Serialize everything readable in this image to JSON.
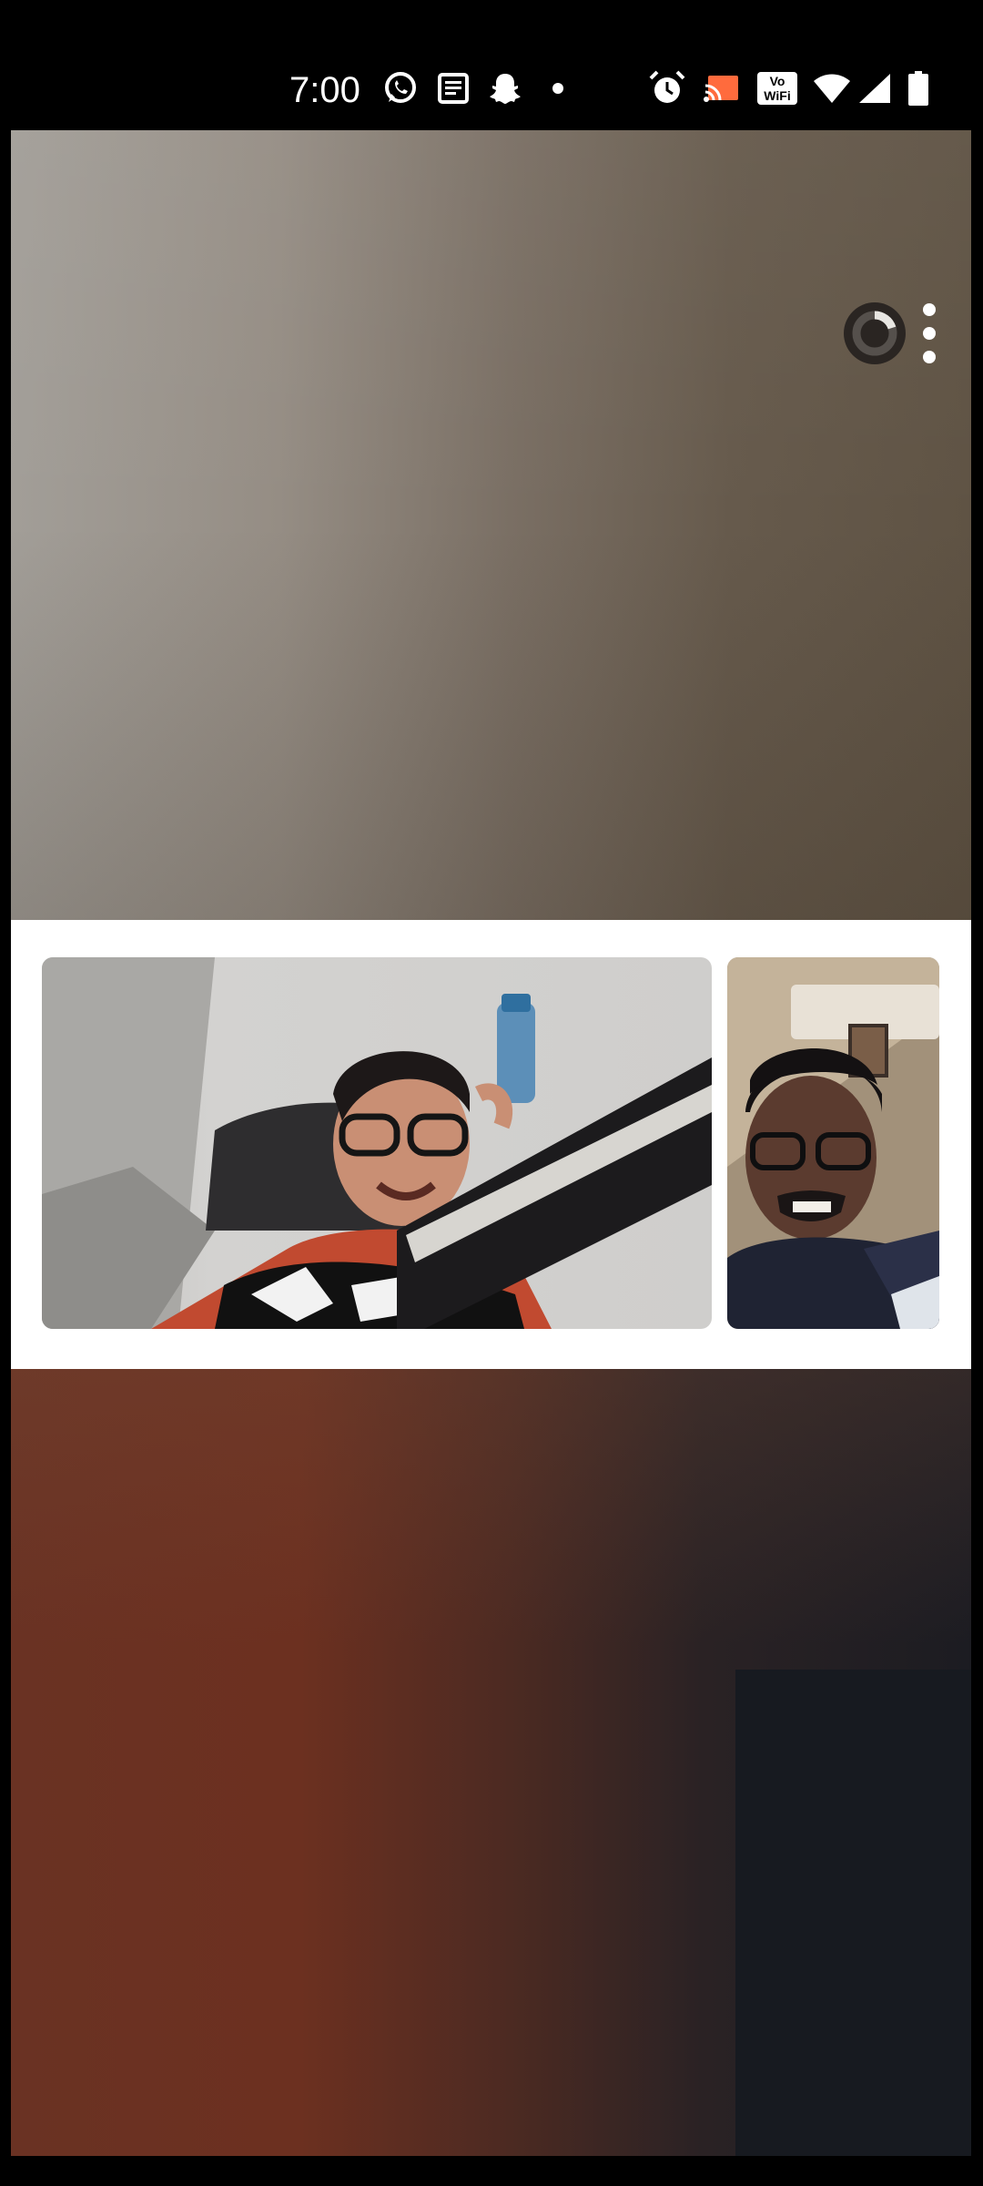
{
  "status_bar": {
    "time": "7:00",
    "left_icons": [
      "whatsapp-icon",
      "news-icon",
      "snapchat-icon",
      "dot-icon"
    ],
    "right_icons": [
      "alarm-icon",
      "cast-icon",
      "vowifi-icon",
      "wifi-icon",
      "signal-icon",
      "battery-icon"
    ],
    "vowifi_text": "Vo WiFi"
  },
  "call": {
    "participants": [
      {
        "tile": "participant-1",
        "description_icon": "video-feed"
      },
      {
        "tile": "participant-2",
        "description_icon": "video-feed"
      }
    ],
    "controls": [
      "loading-spinner-icon",
      "more-options-icon"
    ]
  },
  "colors": {
    "band": "#ffffff",
    "status_bar_bg": "#000000",
    "icon": "#ffffff"
  }
}
